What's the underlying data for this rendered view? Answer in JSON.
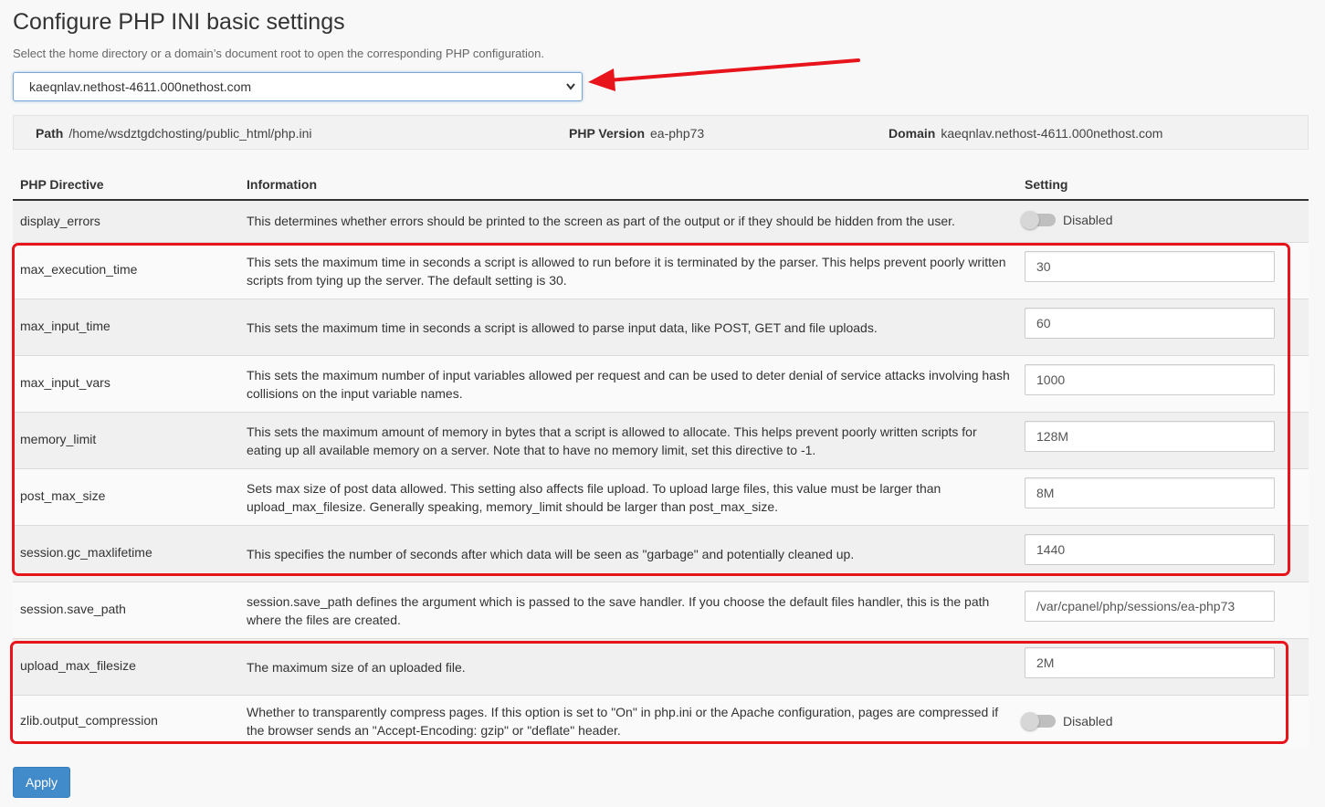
{
  "page": {
    "title": "Configure PHP INI basic settings",
    "subtitle": "Select the home directory or a domain’s document root to open the corresponding PHP configuration."
  },
  "domain_select": {
    "selected": "kaeqnlav.nethost-4611.000nethost.com"
  },
  "info_bar": {
    "path_label": "Path",
    "path_value": "/home/wsdztgdchosting/public_html/php.ini",
    "version_label": "PHP Version",
    "version_value": "ea-php73",
    "domain_label": "Domain",
    "domain_value": "kaeqnlav.nethost-4611.000nethost.com"
  },
  "table": {
    "headers": {
      "directive": "PHP Directive",
      "information": "Information",
      "setting": "Setting"
    },
    "rows": [
      {
        "name": "display_errors",
        "info": "This determines whether errors should be printed to the screen as part of the output or if they should be hidden from the user.",
        "type": "toggle",
        "value": "Disabled"
      },
      {
        "name": "max_execution_time",
        "info": "This sets the maximum time in seconds a script is allowed to run before it is terminated by the parser. This helps prevent poorly written scripts from tying up the server. The default setting is 30.",
        "type": "input",
        "value": "30"
      },
      {
        "name": "max_input_time",
        "info": "This sets the maximum time in seconds a script is allowed to parse input data, like POST, GET and file uploads.",
        "type": "input",
        "value": "60"
      },
      {
        "name": "max_input_vars",
        "info": "This sets the maximum number of input variables allowed per request and can be used to deter denial of service attacks involving hash collisions on the input variable names.",
        "type": "input",
        "value": "1000"
      },
      {
        "name": "memory_limit",
        "info": "This sets the maximum amount of memory in bytes that a script is allowed to allocate. This helps prevent poorly written scripts for eating up all available memory on a server. Note that to have no memory limit, set this directive to -1.",
        "type": "input",
        "value": "128M"
      },
      {
        "name": "post_max_size",
        "info": "Sets max size of post data allowed. This setting also affects file upload. To upload large files, this value must be larger than upload_max_filesize. Generally speaking, memory_limit should be larger than post_max_size.",
        "type": "input",
        "value": "8M"
      },
      {
        "name": "session.gc_maxlifetime",
        "info": "This specifies the number of seconds after which data will be seen as \"garbage\" and potentially cleaned up.",
        "type": "input",
        "value": "1440"
      },
      {
        "name": "session.save_path",
        "info": "session.save_path defines the argument which is passed to the save handler. If you choose the default files handler, this is the path where the files are created.",
        "type": "input",
        "value": "/var/cpanel/php/sessions/ea-php73"
      },
      {
        "name": "upload_max_filesize",
        "info": "The maximum size of an uploaded file.",
        "type": "input",
        "value": "2M"
      },
      {
        "name": "zlib.output_compression",
        "info": "Whether to transparently compress pages. If this option is set to \"On\" in php.ini or the Apache configuration, pages are compressed if the browser sends an \"Accept-Encoding: gzip\" or \"deflate\" header.",
        "type": "toggle",
        "value": "Disabled"
      }
    ]
  },
  "apply_label": "Apply",
  "colors": {
    "annotation": "#e8141c",
    "primary_button": "#428bca"
  }
}
